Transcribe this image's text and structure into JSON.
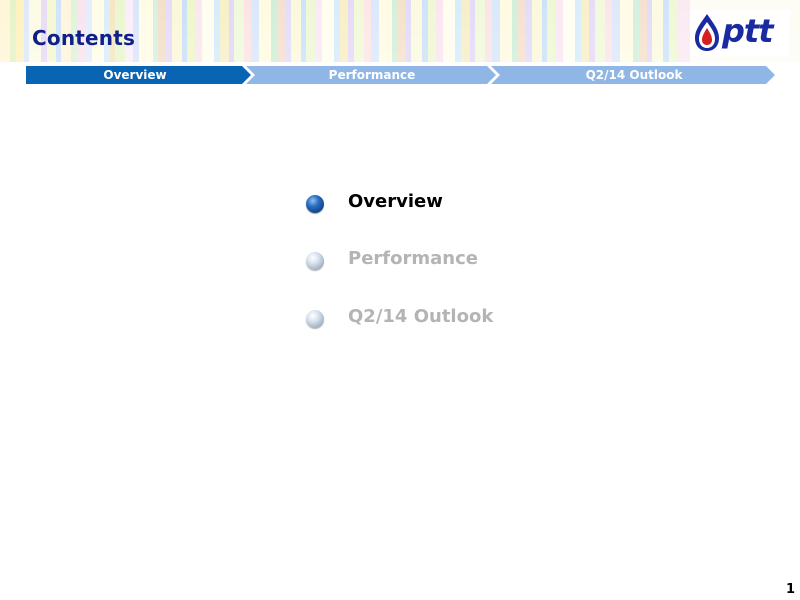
{
  "header": {
    "title": "Contents",
    "logo_text": "ptt"
  },
  "nav": {
    "steps": [
      {
        "label": "Overview",
        "active": true
      },
      {
        "label": "Performance",
        "active": false
      },
      {
        "label": "Q2/14 Outlook",
        "active": false
      }
    ]
  },
  "agenda": {
    "items": [
      {
        "label": "Overview",
        "active": true
      },
      {
        "label": "Performance",
        "active": false
      },
      {
        "label": "Q2/14 Outlook",
        "active": false
      }
    ]
  },
  "footer": {
    "page_number": "1"
  },
  "colors": {
    "title": "#10208a",
    "nav_active": "#0a64b4",
    "nav_inactive": "#8fb6e4",
    "agenda_active": "#000000",
    "agenda_inactive": "#b4b4b4"
  },
  "icons": {
    "active_bullet": "blue-sphere-bullet",
    "inactive_bullet": "grey-sphere-bullet",
    "logo": "ptt-flame-logo"
  }
}
